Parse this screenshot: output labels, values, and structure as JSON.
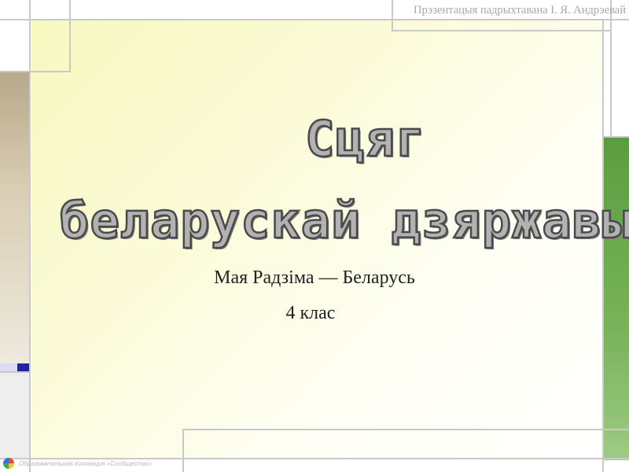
{
  "slide": {
    "credit": "Прэзентацыя падрыхтавана І. Я. Андрэевай",
    "title_line1": "Сцяг",
    "title_line2": "беларускай дзяржавы",
    "subtitle_line1": "Мая Радзіма — Беларусь",
    "subtitle_line2": "4 клас",
    "footer": "Образовательная коллекция «Сообщество»"
  },
  "colors": {
    "tan": "#c6b89a",
    "lime": "#cfe57b",
    "green": "#6ba84f",
    "navy": "#25259a",
    "lavender": "#dcdcf2",
    "panel_gradient_start": "#f8f8c0"
  }
}
